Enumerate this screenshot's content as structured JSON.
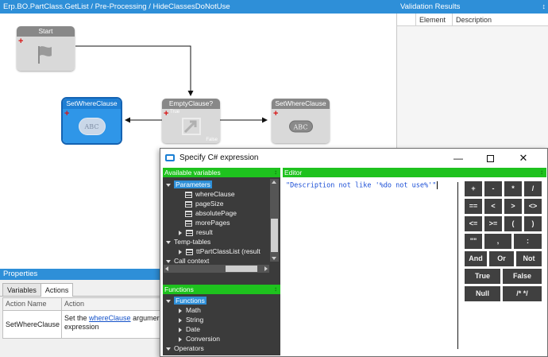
{
  "designer": {
    "header": "Erp.BO.PartClass.GetList / Pre-Processing / HideClassesDoNotUse",
    "nodes": {
      "start": "Start",
      "set_left": "SetWhereClause",
      "condition": "EmptyClause?",
      "set_right": "SetWhereClause"
    },
    "abc_label": "ABC",
    "true_label": "True",
    "false_label": "False"
  },
  "validation": {
    "title": "Validation Results",
    "pin": "↕",
    "columns": [
      "Element",
      "Description"
    ]
  },
  "properties": {
    "title": "Properties",
    "tabs": [
      "Variables",
      "Actions"
    ],
    "active_tab": "Actions",
    "columns": [
      "Action Name",
      "Action"
    ],
    "row": {
      "name": "SetWhereClause",
      "text_before": "Set the ",
      "link": "whereClause",
      "text_after": " argumer",
      "line2": "expression"
    }
  },
  "dialog": {
    "title": "Specify C# expression",
    "controls": {
      "minimize": "—",
      "close": "✕"
    },
    "variables_header": "Available variables",
    "editor_header": "Editor",
    "functions_header": "Functions",
    "pin_glyph": "↕",
    "tree": {
      "parameters": "Parameters",
      "params": [
        "whereClause",
        "pageSize",
        "absolutePage",
        "morePages",
        "result"
      ],
      "temp_tables": "Temp-tables",
      "temp_items": [
        "ttPartClassList (result"
      ],
      "call_context": "Call context"
    },
    "functions_tree": {
      "root": "Functions",
      "items": [
        "Math",
        "String",
        "Date",
        "Conversion"
      ],
      "operators": "Operators"
    },
    "expression": "\"Description not like '%do not use%'\"",
    "keypad": [
      [
        "+",
        "-",
        "*",
        "/"
      ],
      [
        "==",
        "<",
        ">",
        "<>"
      ],
      [
        "<=",
        ">=",
        "(",
        ")"
      ],
      [
        "\"\"",
        ",",
        ":"
      ],
      [
        "And",
        "Or",
        "Not"
      ],
      [
        "True",
        "False"
      ],
      [
        "Null",
        "/* */"
      ]
    ]
  },
  "colors": {
    "panel_header": "#2e8fd8",
    "green_header": "#1ec21e",
    "dark_pane": "#3b3b3b",
    "key": "#404040",
    "expression_text": "#1a4ed6"
  }
}
